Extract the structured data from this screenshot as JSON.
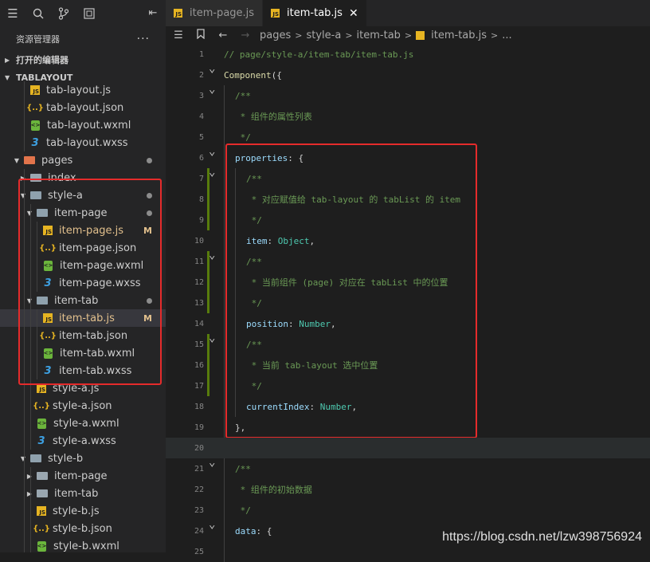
{
  "sidebar": {
    "title": "资源管理器",
    "more_label": "···",
    "open_editors_label": "打开的编辑器",
    "workspace_label": "TABLAYOUT"
  },
  "tabs": [
    {
      "label": "item-page.js",
      "active": false
    },
    {
      "label": "item-tab.js",
      "active": true,
      "close": "✕"
    }
  ],
  "breadcrumb": [
    "pages",
    "style-a",
    "item-tab",
    "item-tab.js",
    "..."
  ],
  "tree": [
    {
      "label": "tab-layout.js",
      "icon": "js",
      "indent": 2
    },
    {
      "label": "tab-layout.json",
      "icon": "json",
      "indent": 2
    },
    {
      "label": "tab-layout.wxml",
      "icon": "wxml",
      "indent": 2
    },
    {
      "label": "tab-layout.wxss",
      "icon": "wxss",
      "indent": 2
    },
    {
      "label": "pages",
      "icon": "folder-pages",
      "indent": 1,
      "twisty": "open",
      "dot": true
    },
    {
      "label": "index",
      "icon": "folder",
      "indent": 2,
      "twisty": "closed"
    },
    {
      "label": "style-a",
      "icon": "folder-open",
      "indent": 2,
      "twisty": "open",
      "dot": true
    },
    {
      "label": "item-page",
      "icon": "folder-open",
      "indent": 3,
      "twisty": "open",
      "dot": true
    },
    {
      "label": "item-page.js",
      "icon": "js",
      "indent": 4,
      "badge": "M",
      "modified": true
    },
    {
      "label": "item-page.json",
      "icon": "json",
      "indent": 4
    },
    {
      "label": "item-page.wxml",
      "icon": "wxml",
      "indent": 4
    },
    {
      "label": "item-page.wxss",
      "icon": "wxss",
      "indent": 4
    },
    {
      "label": "item-tab",
      "icon": "folder-open",
      "indent": 3,
      "twisty": "open",
      "dot": true
    },
    {
      "label": "item-tab.js",
      "icon": "js",
      "indent": 4,
      "badge": "M",
      "modified": true,
      "selected": true
    },
    {
      "label": "item-tab.json",
      "icon": "json",
      "indent": 4
    },
    {
      "label": "item-tab.wxml",
      "icon": "wxml",
      "indent": 4
    },
    {
      "label": "item-tab.wxss",
      "icon": "wxss",
      "indent": 4
    },
    {
      "label": "style-a.js",
      "icon": "js",
      "indent": 3
    },
    {
      "label": "style-a.json",
      "icon": "json",
      "indent": 3
    },
    {
      "label": "style-a.wxml",
      "icon": "wxml",
      "indent": 3
    },
    {
      "label": "style-a.wxss",
      "icon": "wxss",
      "indent": 3
    },
    {
      "label": "style-b",
      "icon": "folder-open",
      "indent": 2,
      "twisty": "open"
    },
    {
      "label": "item-page",
      "icon": "folder",
      "indent": 3,
      "twisty": "closed"
    },
    {
      "label": "item-tab",
      "icon": "folder",
      "indent": 3,
      "twisty": "closed"
    },
    {
      "label": "style-b.js",
      "icon": "js",
      "indent": 3
    },
    {
      "label": "style-b.json",
      "icon": "json",
      "indent": 3
    },
    {
      "label": "style-b.wxml",
      "icon": "wxml",
      "indent": 3
    }
  ],
  "code": [
    {
      "n": "1",
      "indent": 0,
      "tokens": [
        [
          "comment",
          "// page/style-a/item-tab/item-tab.js"
        ]
      ]
    },
    {
      "n": "2",
      "indent": 0,
      "fold": true,
      "tokens": [
        [
          "ident",
          "Component"
        ],
        [
          "plain",
          "({"
        ]
      ]
    },
    {
      "n": "3",
      "indent": 1,
      "fold": true,
      "tokens": [
        [
          "comment",
          "/**"
        ]
      ]
    },
    {
      "n": "4",
      "indent": 1,
      "tokens": [
        [
          "comment",
          " * 组件的属性列表"
        ]
      ]
    },
    {
      "n": "5",
      "indent": 1,
      "tokens": [
        [
          "comment",
          " */"
        ]
      ]
    },
    {
      "n": "6",
      "indent": 1,
      "fold": true,
      "tokens": [
        [
          "prop",
          "properties"
        ],
        [
          "plain",
          ": {"
        ]
      ]
    },
    {
      "n": "7",
      "indent": 2,
      "fold": true,
      "mod": true,
      "tokens": [
        [
          "comment",
          "/**"
        ]
      ]
    },
    {
      "n": "8",
      "indent": 2,
      "mod": true,
      "tokens": [
        [
          "comment",
          " * 对应赋值给 tab-layout 的 tabList 的 item"
        ]
      ]
    },
    {
      "n": "9",
      "indent": 2,
      "mod": true,
      "tokens": [
        [
          "comment",
          " */"
        ]
      ]
    },
    {
      "n": "10",
      "indent": 2,
      "tokens": [
        [
          "prop",
          "item"
        ],
        [
          "plain",
          ": "
        ],
        [
          "type",
          "Object"
        ],
        [
          "plain",
          ","
        ]
      ]
    },
    {
      "n": "11",
      "indent": 2,
      "fold": true,
      "mod": true,
      "tokens": [
        [
          "comment",
          "/**"
        ]
      ]
    },
    {
      "n": "12",
      "indent": 2,
      "mod": true,
      "tokens": [
        [
          "comment",
          " * 当前组件 (page) 对应在 tabList 中的位置"
        ]
      ]
    },
    {
      "n": "13",
      "indent": 2,
      "mod": true,
      "tokens": [
        [
          "comment",
          " */"
        ]
      ]
    },
    {
      "n": "14",
      "indent": 2,
      "tokens": [
        [
          "prop",
          "position"
        ],
        [
          "plain",
          ": "
        ],
        [
          "type",
          "Number"
        ],
        [
          "plain",
          ","
        ]
      ]
    },
    {
      "n": "15",
      "indent": 2,
      "fold": true,
      "mod": true,
      "tokens": [
        [
          "comment",
          "/**"
        ]
      ]
    },
    {
      "n": "16",
      "indent": 2,
      "mod": true,
      "tokens": [
        [
          "comment",
          " * 当前 tab-layout 选中位置"
        ]
      ]
    },
    {
      "n": "17",
      "indent": 2,
      "mod": true,
      "tokens": [
        [
          "comment",
          " */"
        ]
      ]
    },
    {
      "n": "18",
      "indent": 2,
      "tokens": [
        [
          "prop",
          "currentIndex"
        ],
        [
          "plain",
          ": "
        ],
        [
          "type",
          "Number"
        ],
        [
          "plain",
          ","
        ]
      ]
    },
    {
      "n": "19",
      "indent": 1,
      "tokens": [
        [
          "plain",
          "},"
        ]
      ]
    },
    {
      "n": "20",
      "indent": 0,
      "current": true,
      "tokens": []
    },
    {
      "n": "21",
      "indent": 1,
      "fold": true,
      "tokens": [
        [
          "comment",
          "/**"
        ]
      ]
    },
    {
      "n": "22",
      "indent": 1,
      "tokens": [
        [
          "comment",
          " * 组件的初始数据"
        ]
      ]
    },
    {
      "n": "23",
      "indent": 1,
      "tokens": [
        [
          "comment",
          " */"
        ]
      ]
    },
    {
      "n": "24",
      "indent": 1,
      "fold": true,
      "tokens": [
        [
          "prop",
          "data"
        ],
        [
          "plain",
          ": {"
        ]
      ]
    },
    {
      "n": "25",
      "indent": 1,
      "tokens": []
    }
  ],
  "watermark": "https://blog.csdn.net/lzw398756924",
  "colors": {
    "highlight": "#e52b2b",
    "modified": "#e2c08d",
    "added_bar": "#587c0c"
  }
}
